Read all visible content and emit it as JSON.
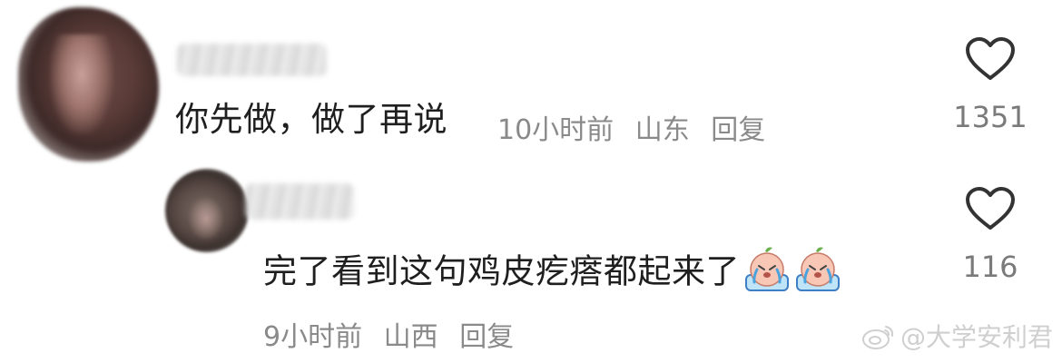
{
  "comments": [
    {
      "text": "你先做，做了再说",
      "time": "10小时前",
      "location": "山东",
      "reply_label": "回复",
      "likes": "1351"
    },
    {
      "text": "完了看到这句鸡皮疙瘩都起来了",
      "time": "9小时前",
      "location": "山西",
      "reply_label": "回复",
      "likes": "116",
      "emojis": [
        "crying-face-emoji",
        "crying-face-emoji"
      ]
    }
  ],
  "watermark": "@大学安利君",
  "colors": {
    "text": "#1f1f1f",
    "meta": "#8a8a8a",
    "heart": "#333333"
  }
}
